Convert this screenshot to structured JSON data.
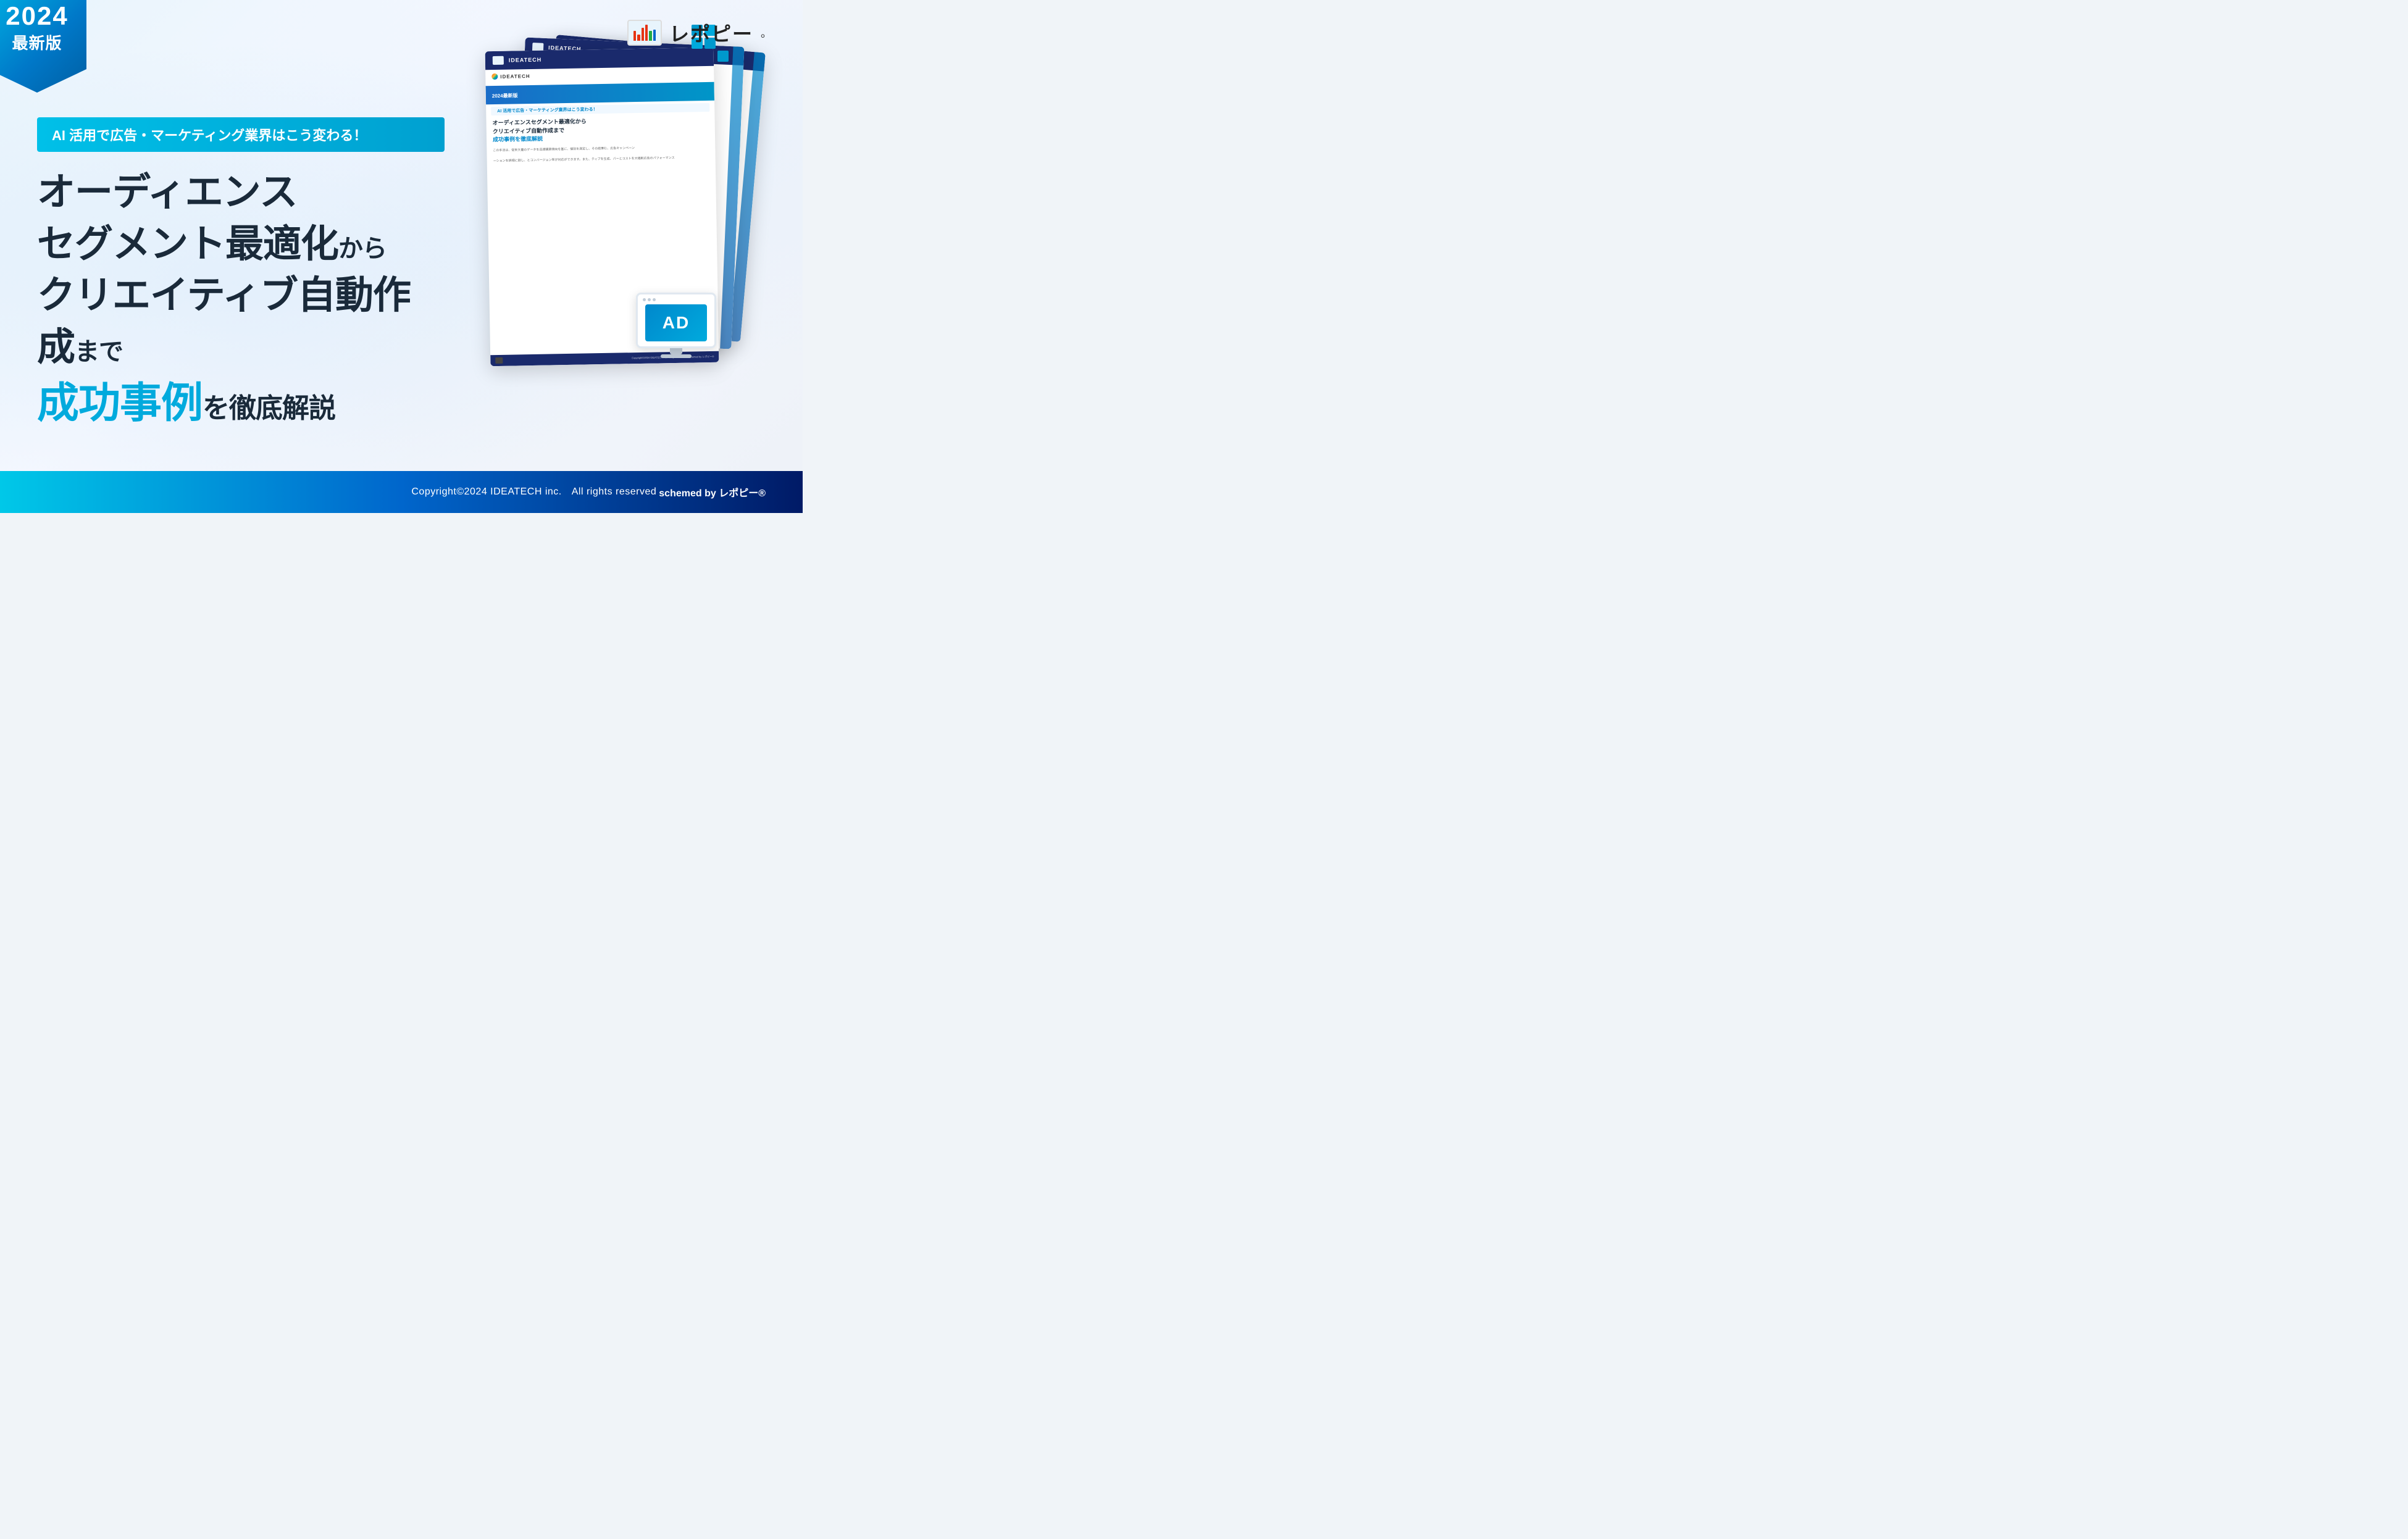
{
  "badge": {
    "year": "2024",
    "label": "最新版"
  },
  "logo": {
    "name": "レポピー",
    "symbol": "■"
  },
  "subtitle_banner": "AI 活用で広告・マーケティング業界はこう変わる！",
  "headline": {
    "line1": "オーディエンス",
    "line2_main": "セグメント最適化",
    "line2_suffix": "から",
    "line3_main": "クリエイティブ自動作成",
    "line3_suffix": "まで",
    "line4_blue": "成功事例",
    "line4_suffix": "を徹底解説"
  },
  "document": {
    "brand": "IDEATECH",
    "year_badge": "2024最新版",
    "sub_label": "AI 活用で広告・マーケティング業界はこう変わる！",
    "title_part1": "オーディエンスセグメント最適化から",
    "title_part2": "クリエイティブ自動作成まで",
    "title_blue": "成功事例を徹底解説",
    "body_text": "この手法は、従来大量のデータを迅速購買傾向を基に、個別を測定し、その結果む、広告キャンペーン",
    "body_text2": "ーションを詳細に割し、とコンバージョン率が対応ができます。また、ティブを生成、バーとコストを大幅削広告のパフォーマンス",
    "footer_copy": "Copyright©2024  IDEATECH inc.",
    "footer_rights": "All rights reserved",
    "footer_scheme": "schemed by レポピー®"
  },
  "footer": {
    "copyright": "Copyright©2024 IDEATECH inc.",
    "rights": "All rights reserved",
    "scheme": "schemed by レポピー®"
  },
  "monitor": {
    "ad_text": "AD"
  },
  "pixels": {
    "colors": [
      "#0099cc",
      "#00aadd",
      "#transparent",
      "#00aadd",
      "#0099cc",
      "#transparent",
      "#transparent",
      "#transparent",
      "#0099cc"
    ]
  }
}
